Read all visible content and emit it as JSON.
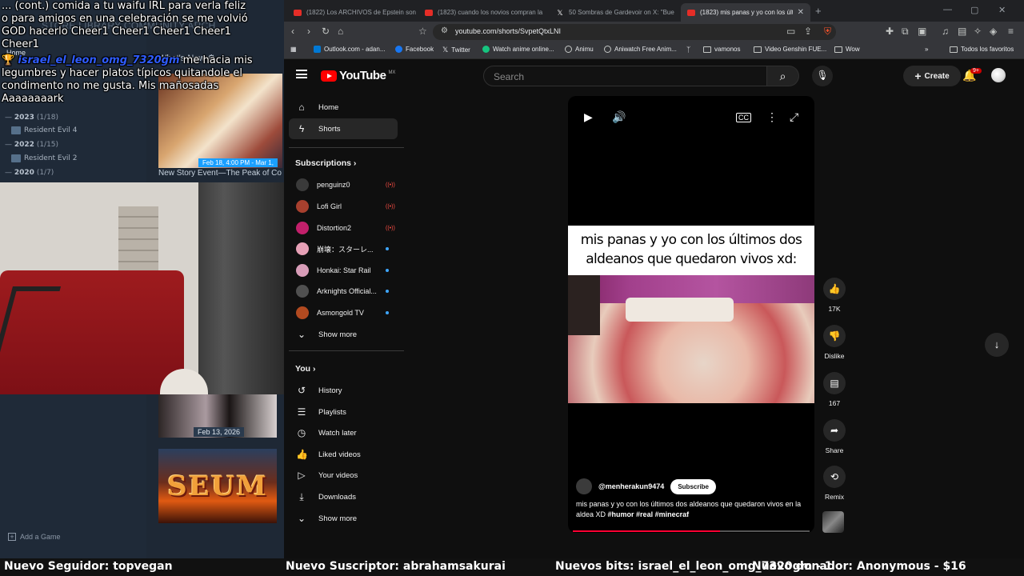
{
  "stream": {
    "chat_line1": "... (cont.) comida a tu waifu IRL para verla feliz o para amigos en una celebración se me volvió GOD hacerlo Cheer1 Cheer1 Cheer1 Cheer1 Cheer1",
    "chat_user2": "israel_el_leon_omg_7320gm",
    "chat_line2_suffix": "me hacia mis legumbres y hacer platos típicos quitandole el condimento no me gusta. Mis mañosadas Aaaaaaaark",
    "steam_nav": "STORE   LIBRARY   COMMUNITY   ARCH",
    "steam_home": "Home",
    "steam_whatsnew": "What's New ⚙",
    "steam_years": [
      {
        "year": "2023",
        "count": "(1/18)"
      },
      {
        "year": "2022",
        "count": "(1/15)"
      },
      {
        "year": "2020",
        "count": "(1/7)"
      }
    ],
    "steam_games": [
      "Resident Evil 4",
      "Resident Evil 2"
    ],
    "steam_event_date": "Feb 18, 4:00 PM - Mar 1,",
    "steam_event_title": "New Story Event—The Peak of Co",
    "steam_date2": "Feb 13, 2026",
    "seum_text": "SEUM",
    "steam_addgame": "Add a Game"
  },
  "ticker": {
    "follower": "Nuevo Seguidor: topvegan",
    "subscriber": "Nuevo Suscriptor: abrahamsakurai",
    "bits": "Nuevos bits: israel_el_leon_omg_7320gm - 1",
    "donor": "Nuevo donador: Anonymous - $16"
  },
  "browser": {
    "tabs": [
      {
        "label": "(1822) Los ARCHIVOS de Epstein son",
        "icon": "youtube-icon"
      },
      {
        "label": "(1823) cuando los novios compran la",
        "icon": "youtube-icon"
      },
      {
        "label": "50 Sombras de Gardevoir on X: \"Bue",
        "icon": "x-icon"
      },
      {
        "label": "(1823) mis panas y yo con los últimos",
        "icon": "youtube-icon"
      }
    ],
    "url": "youtube.com/shorts/SvpetQtxLNI",
    "bookmarks": [
      "Outlook.com - adan...",
      "Facebook",
      "Twitter",
      "Watch anime online...",
      "Animu",
      "Aniwatch Free Anim...",
      "vamonos",
      "Video Genshin FUE...",
      "Wow",
      "Todos los favoritos"
    ]
  },
  "youtube": {
    "logo": "YouTube",
    "country": "MX",
    "search_placeholder": "Search",
    "create_label": "Create",
    "bell_badge": "9+",
    "nav": {
      "home": "Home",
      "shorts": "Shorts"
    },
    "subscriptions_title": "Subscriptions ›",
    "subscriptions": [
      {
        "name": "penguinz0",
        "status": "live",
        "color": "#3a3a3a"
      },
      {
        "name": "Lofi Girl",
        "status": "live",
        "color": "#a8402e"
      },
      {
        "name": "Distortion2",
        "status": "live",
        "color": "#c2206b"
      },
      {
        "name": "崩壊：スターレ...",
        "status": "new",
        "color": "#e6a0b6"
      },
      {
        "name": "Honkai: Star Rail",
        "status": "new",
        "color": "#d89db8"
      },
      {
        "name": "Arknights Official...",
        "status": "new",
        "color": "#505050"
      },
      {
        "name": "Asmongold TV",
        "status": "new",
        "color": "#b24a20"
      }
    ],
    "show_more": "Show more",
    "you_title": "You ›",
    "you_items": [
      "History",
      "Playlists",
      "Watch later",
      "Liked videos",
      "Your videos",
      "Downloads"
    ],
    "short": {
      "caption": "mis panas y yo con los últimos dos aldeanos que quedaron vivos xd:",
      "channel": "@menherakun9474",
      "subscribe": "Subscribe",
      "title": "mis panas y yo con los últimos dos aldeanos que quedaron vivos en la aldea XD",
      "hashtags": "#humor #real #minecraf",
      "progress": 0.62
    },
    "actions": {
      "likes": "17K",
      "dislike": "Dislike",
      "comments": "167",
      "share": "Share",
      "remix": "Remix"
    }
  }
}
